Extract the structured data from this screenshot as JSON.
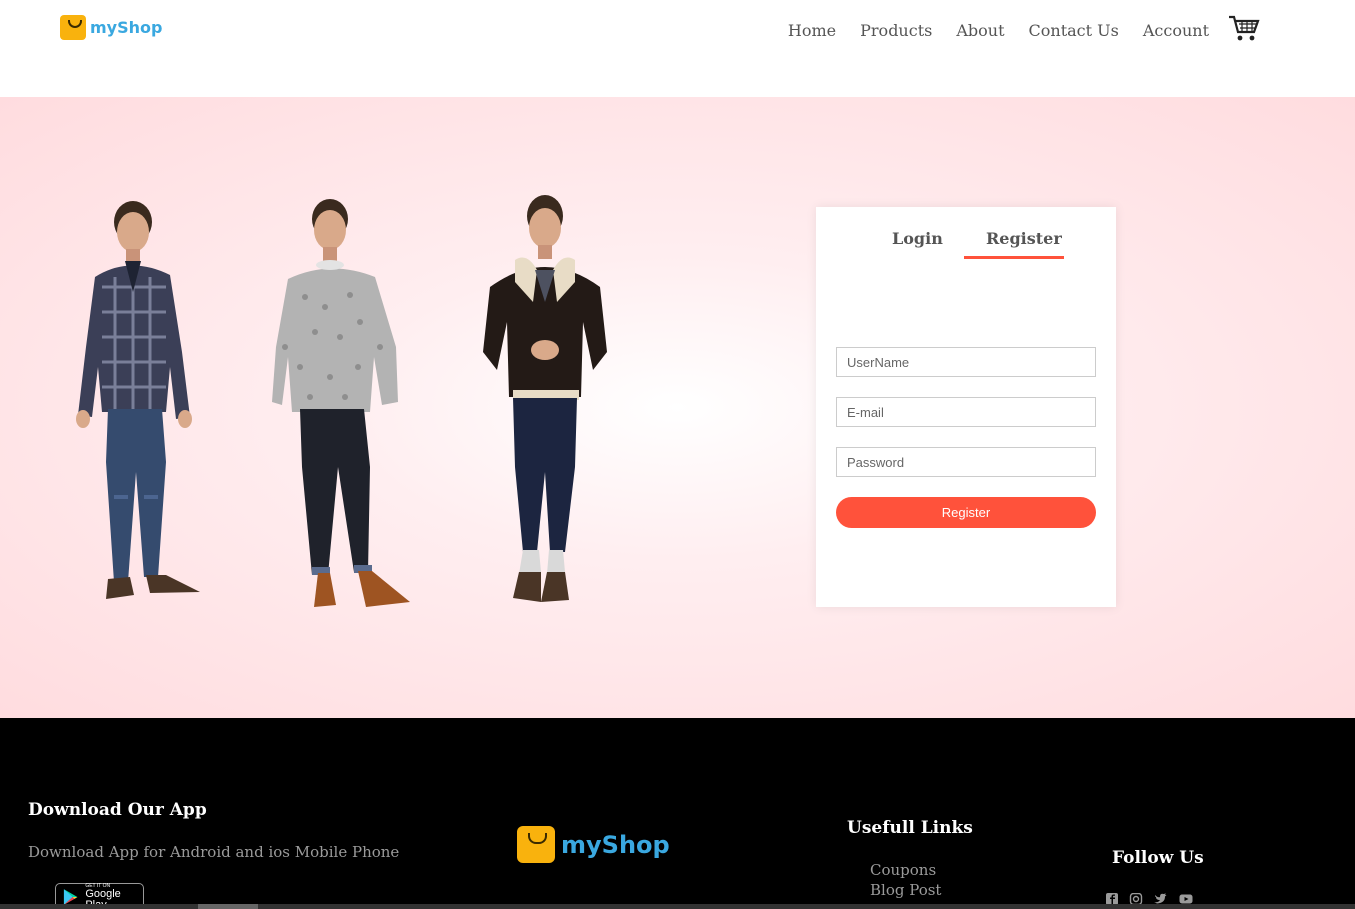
{
  "brand": {
    "name": "myShop",
    "accent": "#ff523b",
    "logo_color": "#3aa8e0"
  },
  "nav": {
    "items": [
      "Home",
      "Products",
      "About",
      "Contact Us",
      "Account"
    ],
    "cart_icon": "cart-icon"
  },
  "form": {
    "tabs": [
      "Login",
      "Register"
    ],
    "active_tab": "Register",
    "fields": {
      "username_placeholder": "UserName",
      "email_placeholder": "E-mail",
      "password_placeholder": "Password"
    },
    "submit_label": "Register"
  },
  "footer": {
    "app_title": "Download Our App",
    "app_text": "Download App for Android and ios Mobile Phone",
    "google_play_small": "GET IT ON",
    "google_play_big": "Google Play",
    "links_title": "Usefull Links",
    "links": [
      "Coupons",
      "Blog Post"
    ],
    "follow_title": "Follow Us",
    "social_icons": [
      "facebook-icon",
      "instagram-icon",
      "twitter-icon",
      "youtube-icon"
    ]
  }
}
